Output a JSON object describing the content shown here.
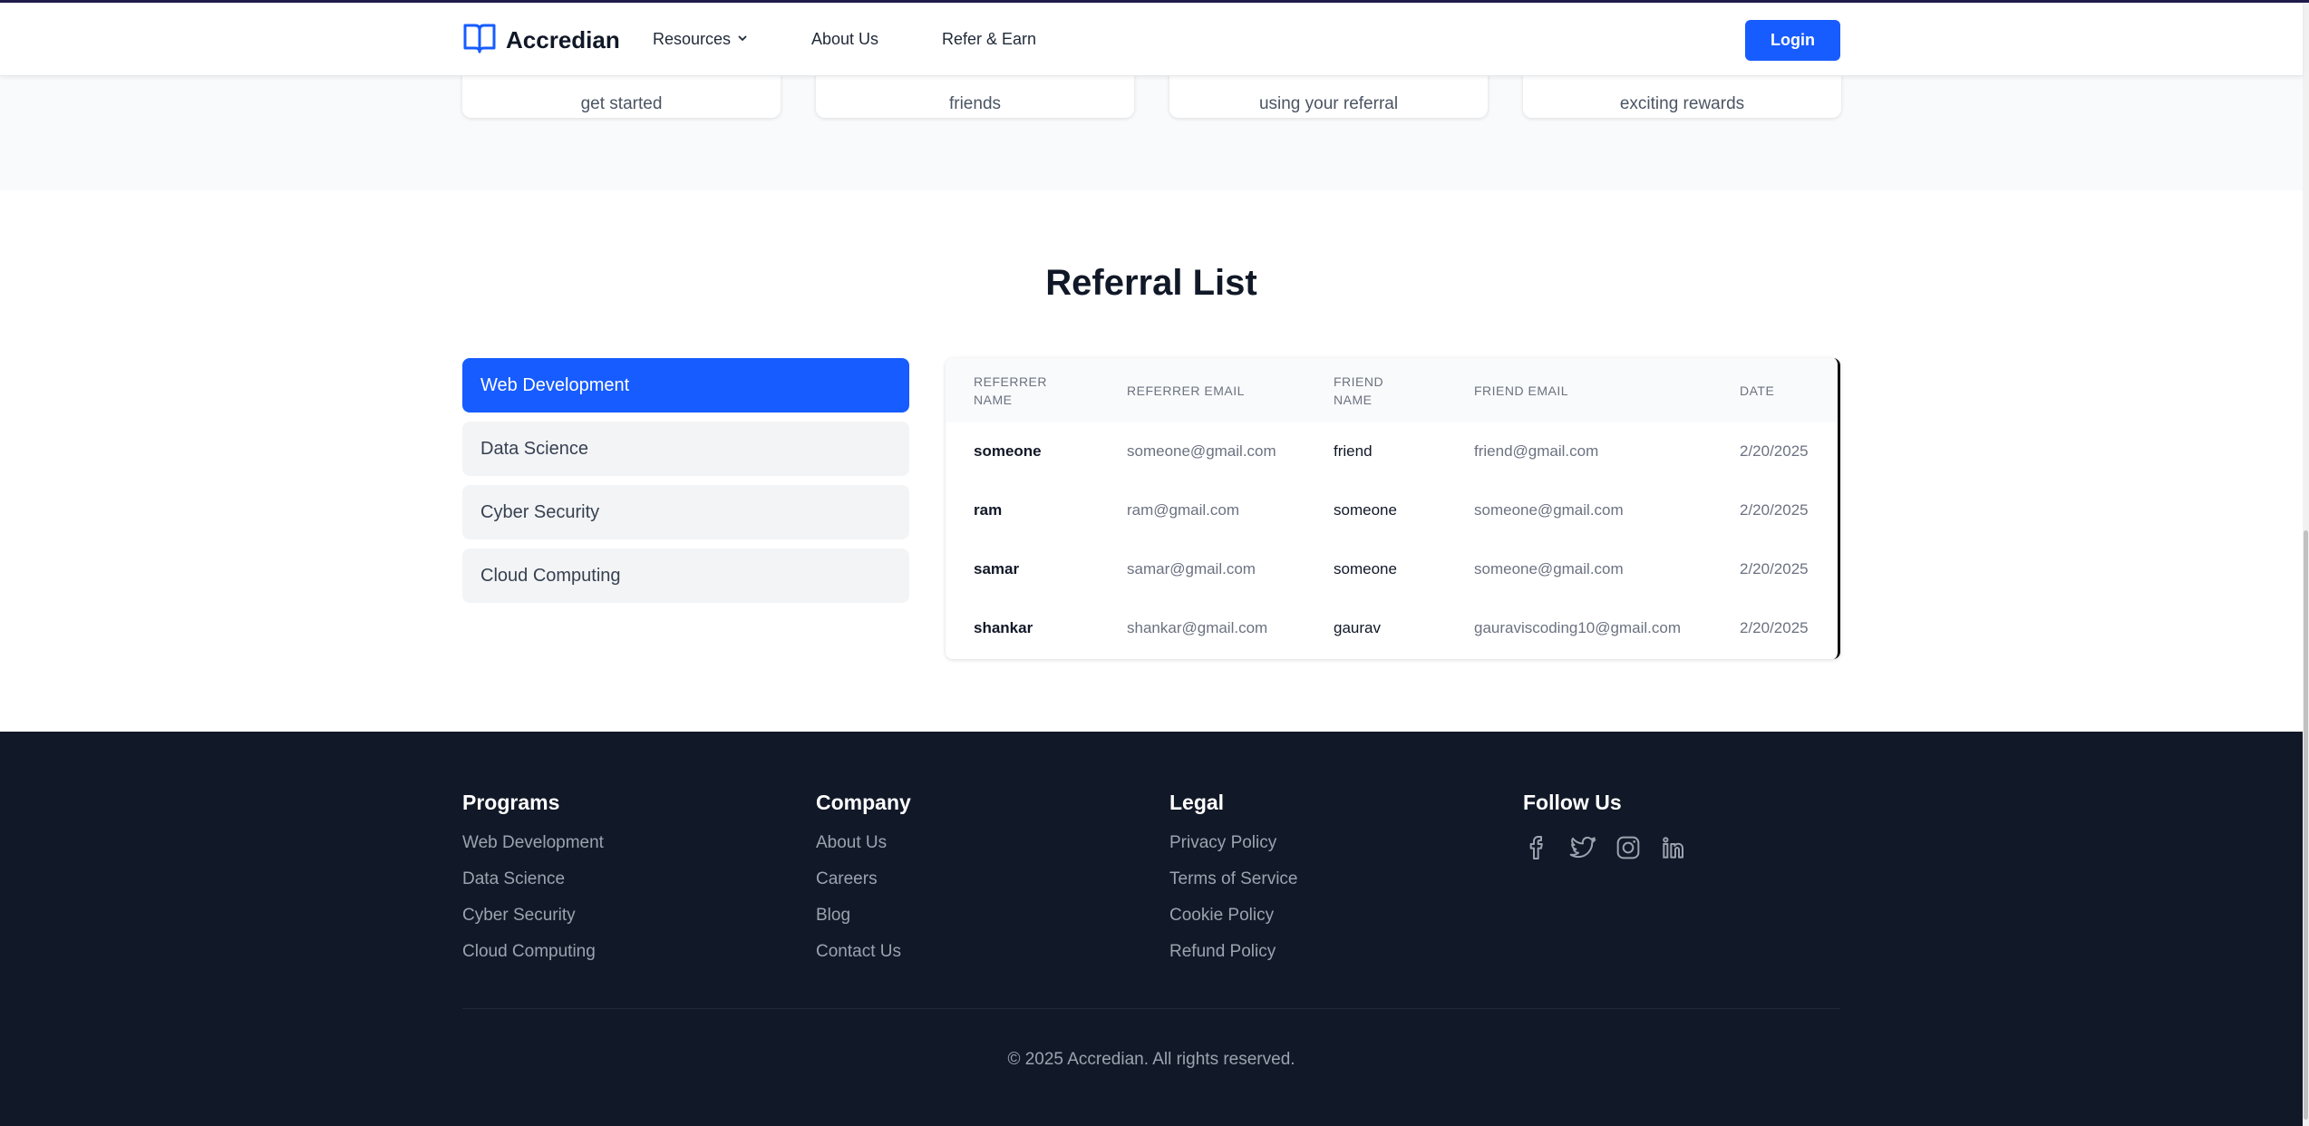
{
  "header": {
    "brand": "Accredian",
    "nav": {
      "resources": "Resources",
      "about": "About Us",
      "refer": "Refer & Earn"
    },
    "login": "Login"
  },
  "steps": [
    {
      "text": "get started"
    },
    {
      "text": "friends"
    },
    {
      "text": "using your referral"
    },
    {
      "text": "exciting rewards"
    }
  ],
  "referral": {
    "title": "Referral List",
    "categories": [
      {
        "label": "Web Development",
        "active": true
      },
      {
        "label": "Data Science",
        "active": false
      },
      {
        "label": "Cyber Security",
        "active": false
      },
      {
        "label": "Cloud Computing",
        "active": false
      }
    ],
    "columns": {
      "referrer_name_1": "REFERRER",
      "referrer_name_2": "NAME",
      "referrer_email": "REFERRER EMAIL",
      "friend_name_1": "FRIEND",
      "friend_name_2": "NAME",
      "friend_email": "FRIEND EMAIL",
      "date": "DATE"
    },
    "rows": [
      {
        "referrer_name": "someone",
        "referrer_email": "someone@gmail.com",
        "friend_name": "friend",
        "friend_email": "friend@gmail.com",
        "date": "2/20/2025"
      },
      {
        "referrer_name": "ram",
        "referrer_email": "ram@gmail.com",
        "friend_name": "someone",
        "friend_email": "someone@gmail.com",
        "date": "2/20/2025"
      },
      {
        "referrer_name": "samar",
        "referrer_email": "samar@gmail.com",
        "friend_name": "someone",
        "friend_email": "someone@gmail.com",
        "date": "2/20/2025"
      },
      {
        "referrer_name": "shankar",
        "referrer_email": "shankar@gmail.com",
        "friend_name": "gaurav",
        "friend_email": "gauraviscoding10@gmail.com",
        "date": "2/20/2025"
      }
    ]
  },
  "footer": {
    "programs": {
      "title": "Programs",
      "links": [
        "Web Development",
        "Data Science",
        "Cyber Security",
        "Cloud Computing"
      ]
    },
    "company": {
      "title": "Company",
      "links": [
        "About Us",
        "Careers",
        "Blog",
        "Contact Us"
      ]
    },
    "legal": {
      "title": "Legal",
      "links": [
        "Privacy Policy",
        "Terms of Service",
        "Cookie Policy",
        "Refund Policy"
      ]
    },
    "follow": {
      "title": "Follow Us",
      "icons": [
        "facebook-icon",
        "twitter-icon",
        "instagram-icon",
        "linkedin-icon"
      ]
    },
    "copyright": "© 2025 Accredian. All rights reserved."
  },
  "colors": {
    "accent": "#175cff",
    "footer_bg": "#111827",
    "band_bg": "#f9fafb"
  }
}
